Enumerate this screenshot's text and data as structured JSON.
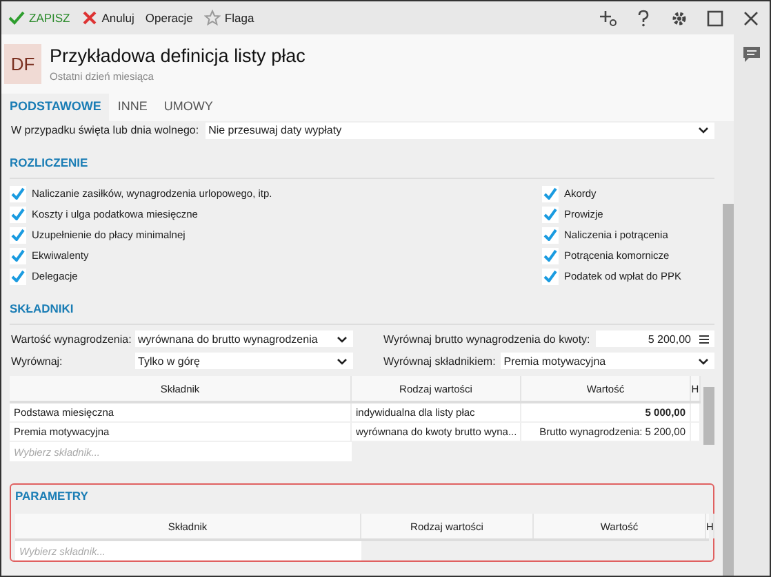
{
  "toolbar": {
    "actions": [
      {
        "kind": "save",
        "label": "ZAPISZ"
      },
      {
        "kind": "cancel",
        "label": "Anuluj"
      },
      {
        "kind": "plain",
        "label": "Operacje"
      },
      {
        "kind": "flag",
        "label": "Flaga"
      }
    ]
  },
  "header": {
    "badge": "DF",
    "title": "Przykładowa definicja listy płac",
    "subtitle": "Ostatni dzień miesiąca"
  },
  "tabs": [
    {
      "label": "PODSTAWOWE",
      "selected": true
    },
    {
      "label": "INNE",
      "selected": false
    },
    {
      "label": "UMOWY",
      "selected": false
    }
  ],
  "holiday_row": {
    "label": "W przypadku święta lub dnia wolnego:",
    "value": "Nie przesuwaj daty wypłaty"
  },
  "rozliczenie": {
    "title": "ROZLICZENIE",
    "left": [
      {
        "label": "Naliczanie zasiłków, wynagrodzenia urlopowego, itp.",
        "checked": true
      },
      {
        "label": "Koszty i ulga podatkowa miesięczne",
        "checked": true
      },
      {
        "label": "Uzupełnienie do płacy minimalnej",
        "checked": true
      },
      {
        "label": "Ekwiwalenty",
        "checked": true
      },
      {
        "label": "Delegacje",
        "checked": true
      }
    ],
    "right": [
      {
        "label": "Akordy",
        "checked": true
      },
      {
        "label": "Prowizje",
        "checked": true
      },
      {
        "label": "Naliczenia i potrącenia",
        "checked": true
      },
      {
        "label": "Potrącenia komornicze",
        "checked": true
      },
      {
        "label": "Podatek od wpłat do PPK",
        "checked": true
      }
    ]
  },
  "skladniki": {
    "title": "SKŁADNIKI",
    "fields": [
      {
        "label": "Wartość wynagrodzenia:",
        "value": "wyrównana do brutto wynagrodzenia",
        "kind": "select"
      },
      {
        "label": "Wyrównaj brutto wynagrodzenia do kwoty:",
        "value": "5 200,00",
        "kind": "amount"
      },
      {
        "label": "Wyrównaj:",
        "value": "Tylko w górę",
        "kind": "select"
      },
      {
        "label": "Wyrównaj składnikiem:",
        "value": "Premia motywacyjna",
        "kind": "select"
      }
    ],
    "table": {
      "columns": [
        "Składnik",
        "Rodzaj wartości",
        "Wartość",
        "H"
      ],
      "rows": [
        {
          "cells": [
            "Podstawa miesięczna",
            "indywidualna dla listy płac",
            "5 000,00"
          ],
          "bold_value": true
        },
        {
          "cells": [
            "Premia motywacyjna",
            "wyrównana do kwoty brutto wyna...",
            "Brutto wynagrodzenia: 5 200,00"
          ],
          "bold_value": false
        }
      ],
      "placeholder": "Wybierz składnik..."
    }
  },
  "parametry": {
    "title": "PARAMETRY",
    "table": {
      "columns": [
        "Składnik",
        "Rodzaj wartości",
        "Wartość",
        "H"
      ],
      "placeholder": "Wybierz składnik..."
    }
  }
}
